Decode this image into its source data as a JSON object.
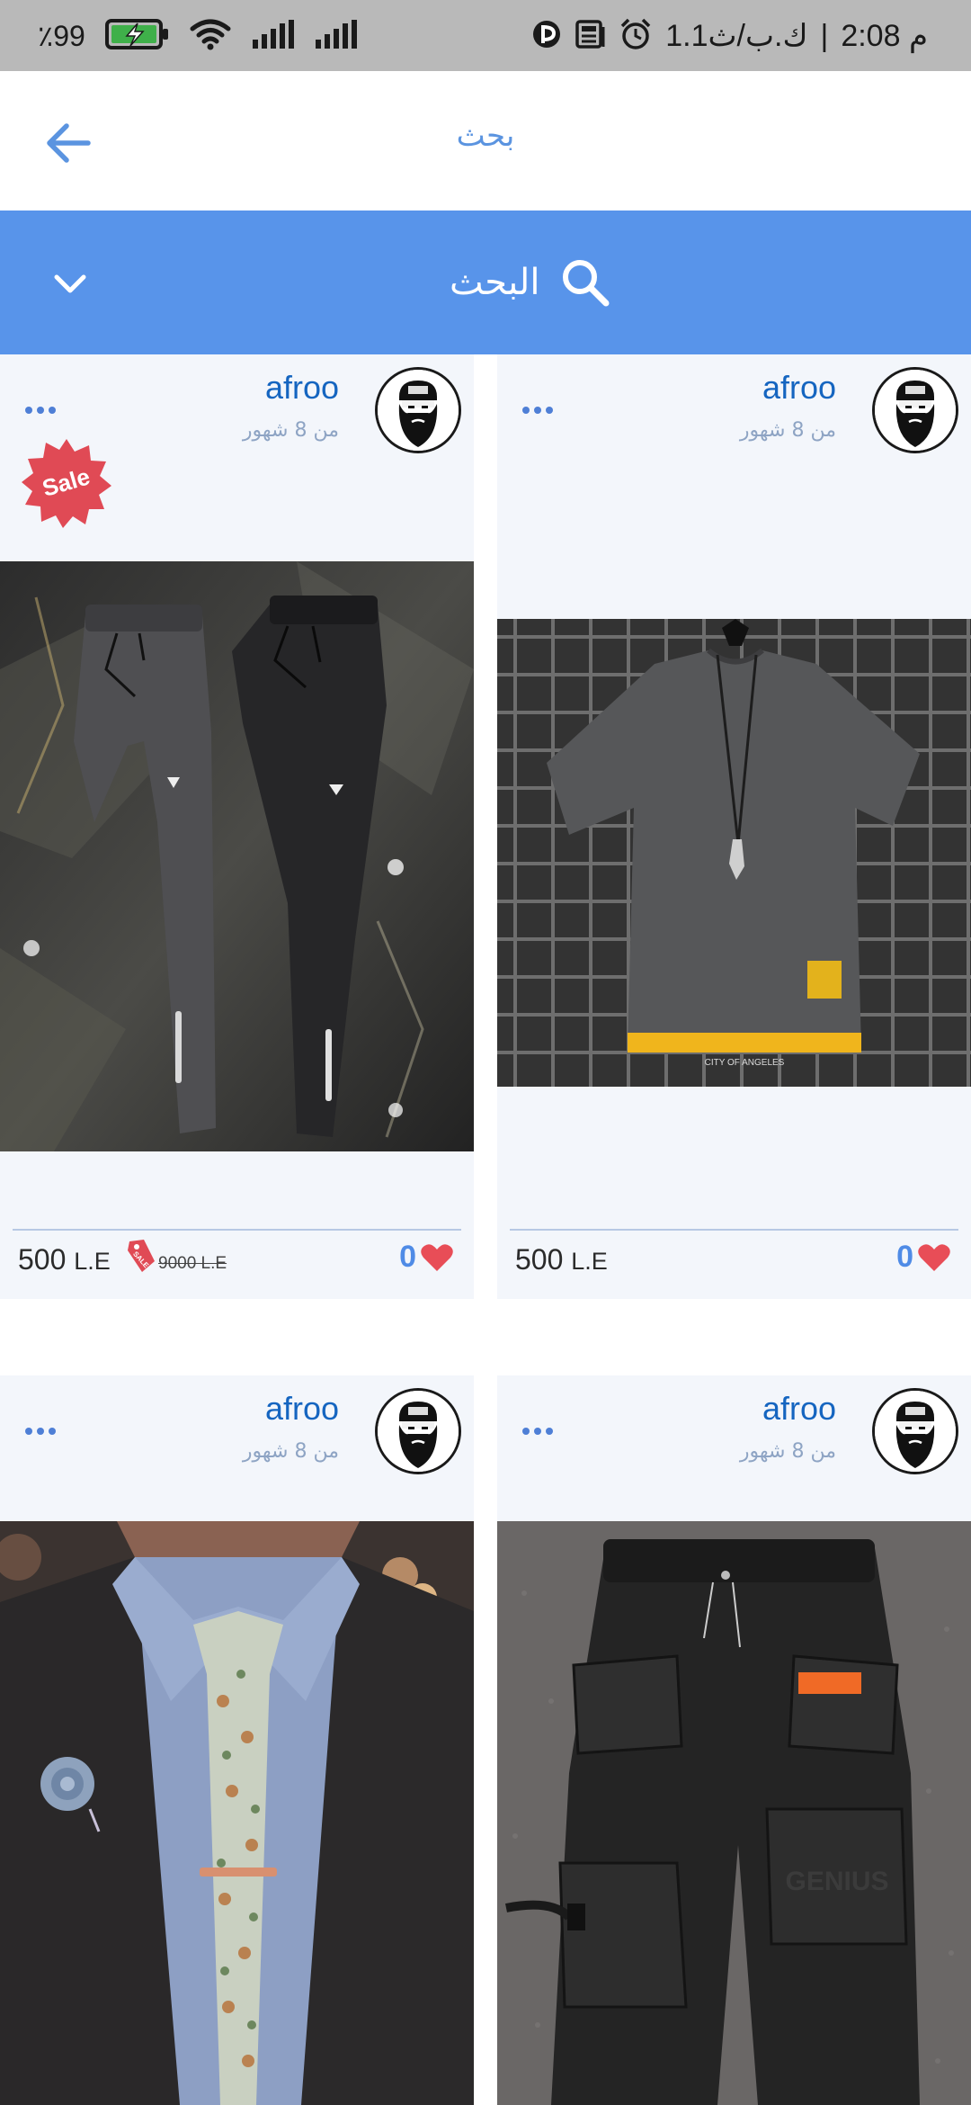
{
  "status_bar": {
    "battery_percent": "99",
    "percent_sign": "٪",
    "time": "2:08 م",
    "network_speed": "1.1ك.ب/ث"
  },
  "header": {
    "title": "بحث",
    "accent_color": "#5b94e0"
  },
  "search": {
    "label": "البحث",
    "bar_color": "#5894ea"
  },
  "cards": [
    {
      "author": "afroo",
      "time_ago": "من 8 شهور",
      "image": "dark-pants",
      "sale_badge": "Sale",
      "price_value": "500",
      "price_unit": "L.E",
      "old_price": "9000 L.E",
      "tag_label": "SALE",
      "likes": "0"
    },
    {
      "author": "afroo",
      "time_ago": "من 8 شهور",
      "image": "gray-tshirt",
      "price_value": "500",
      "price_unit": "L.E",
      "likes": "0"
    },
    {
      "author": "afroo",
      "time_ago": "من 8 شهور",
      "image": "suit-tie"
    },
    {
      "author": "afroo",
      "time_ago": "من 8 شهور",
      "image": "cargo-pants"
    }
  ],
  "colors": {
    "sale_red": "#e04a55",
    "like_red": "#e84d57",
    "link_blue": "#1565c0"
  }
}
